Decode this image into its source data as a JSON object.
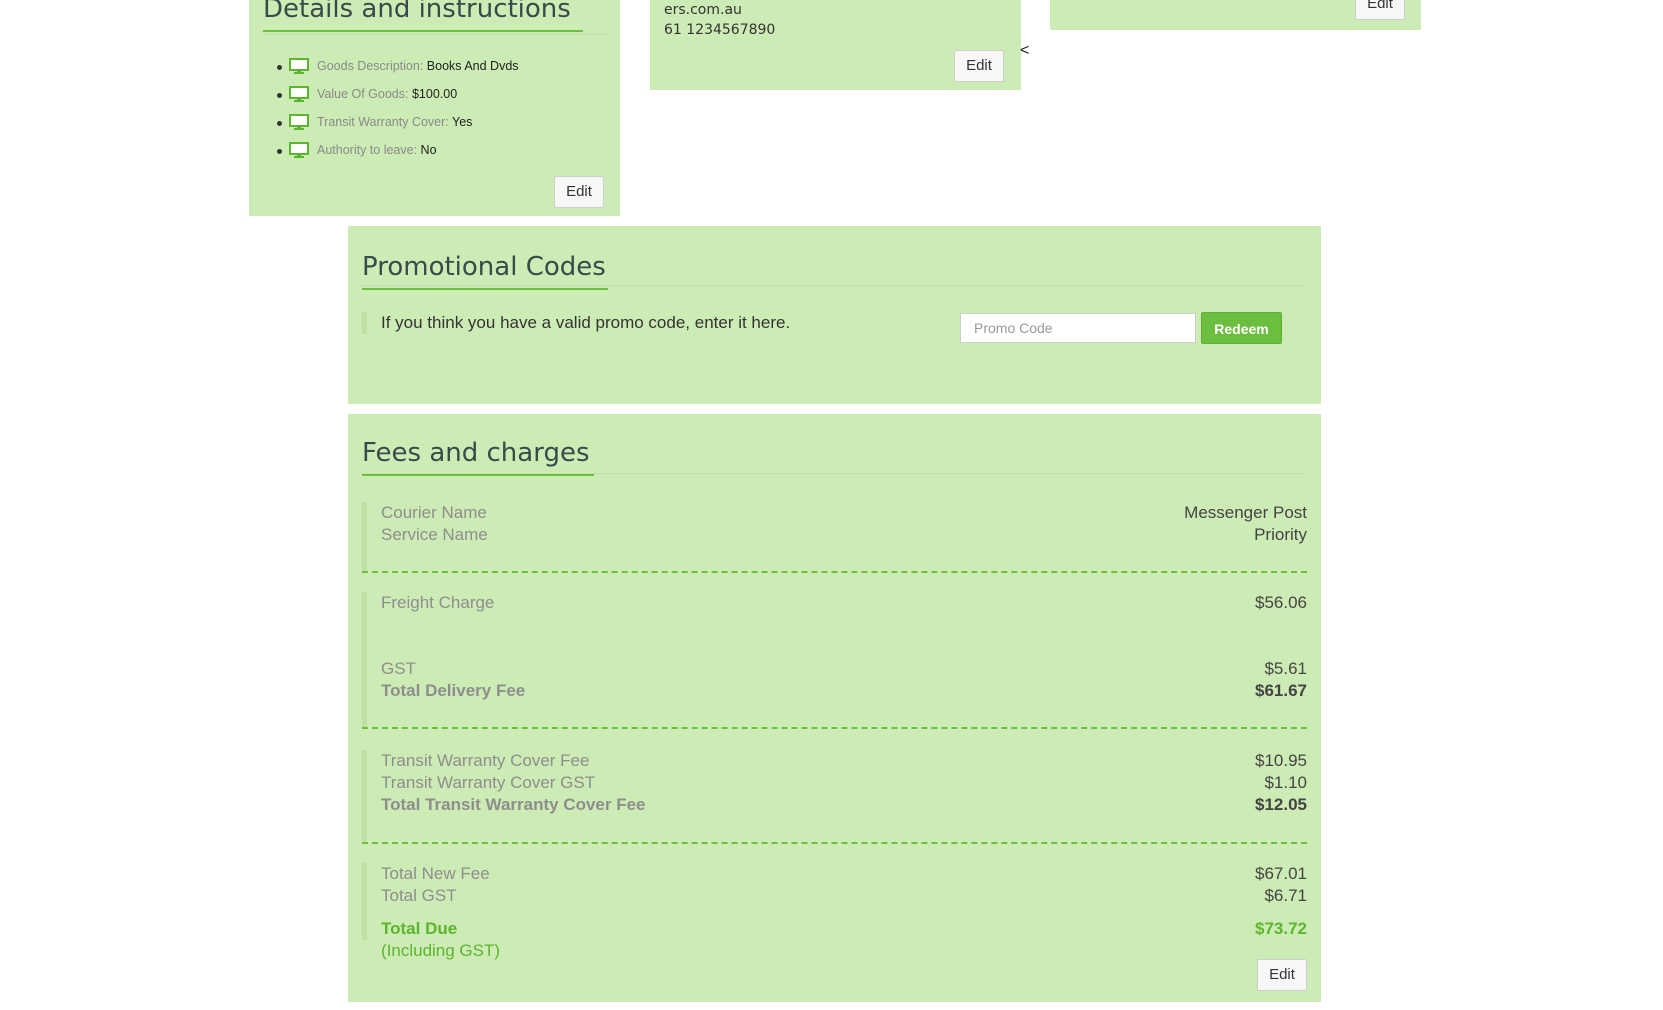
{
  "details": {
    "title": "Details and instructions",
    "items": [
      {
        "label": "Goods Description:",
        "value": "Books And Dvds"
      },
      {
        "label": "Value Of Goods:",
        "value": "$100.00"
      },
      {
        "label": "Transit Warranty Cover:",
        "value": "Yes"
      },
      {
        "label": "Authority to leave:",
        "value": "No"
      }
    ],
    "edit_label": "Edit"
  },
  "address": {
    "email_fragment": "ers.com.au",
    "phone": "61 1234567890",
    "edit_label": "Edit"
  },
  "collapse_glyph": "<",
  "right_panel": {
    "edit_label": "Edit"
  },
  "promo": {
    "title": "Promotional Codes",
    "hint": "If you think you have a valid promo code, enter it here.",
    "input_placeholder": "Promo Code",
    "input_value": "",
    "redeem_label": "Redeem"
  },
  "fees": {
    "title": "Fees and charges",
    "courier_label": "Courier Name",
    "courier_value": "Messenger Post",
    "service_label": "Service Name",
    "service_value": "Priority",
    "freight_label": "Freight Charge",
    "freight_value": "$56.06",
    "gst_label": "GST",
    "gst_value": "$5.61",
    "total_delivery_label": "Total Delivery Fee",
    "total_delivery_value": "$61.67",
    "warranty_fee_label": "Transit Warranty Cover Fee",
    "warranty_fee_value": "$10.95",
    "warranty_gst_label": "Transit Warranty Cover GST",
    "warranty_gst_value": "$1.10",
    "warranty_total_label": "Total Transit Warranty Cover Fee",
    "warranty_total_value": "$12.05",
    "total_new_label": "Total New Fee",
    "total_new_value": "$67.01",
    "total_gst_label": "Total GST",
    "total_gst_value": "$6.71",
    "total_due_label": "Total Due",
    "total_due_value": "$73.72",
    "including_gst": "(Including GST)",
    "edit_label": "Edit"
  },
  "colors": {
    "panel": "#cdebb4",
    "accent": "#6cbf3e",
    "heading": "#3a4a4a"
  },
  "icons": [
    "monitor-icon"
  ]
}
